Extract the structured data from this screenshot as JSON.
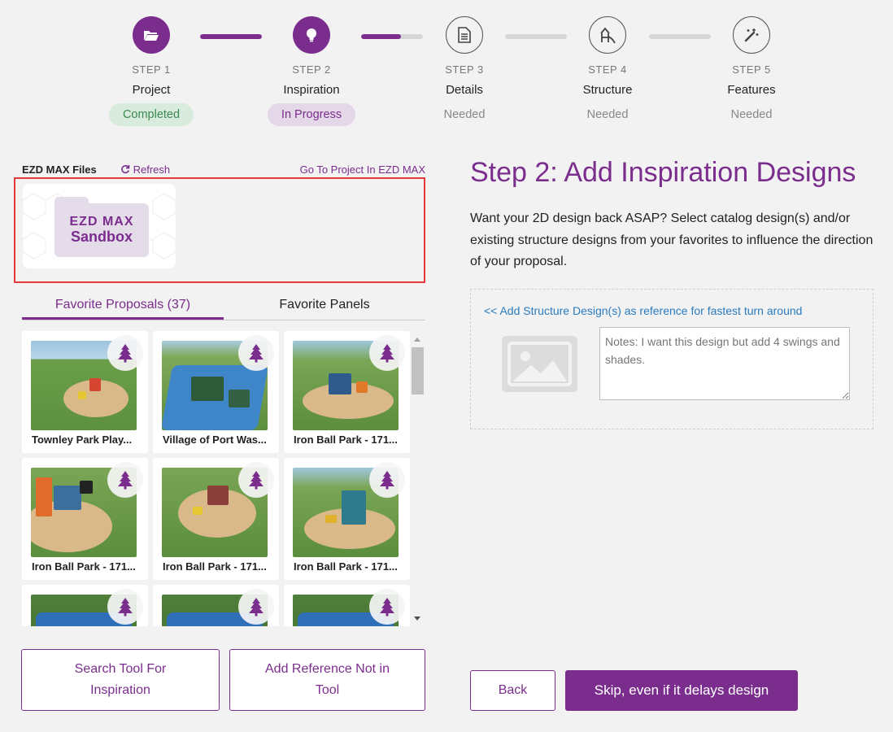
{
  "colors": {
    "accent": "#7b2d8e",
    "completed_bg": "#d9ebdd",
    "completed_text": "#3a8a50",
    "progress_bg": "#e4d7e8",
    "link_blue": "#2a7bbf",
    "highlight_red": "#e33b3b"
  },
  "steps": [
    {
      "number": "STEP 1",
      "name": "Project",
      "status": "Completed",
      "icon": "folder-open-icon"
    },
    {
      "number": "STEP 2",
      "name": "Inspiration",
      "status": "In Progress",
      "icon": "lightbulb-icon"
    },
    {
      "number": "STEP 3",
      "name": "Details",
      "status": "Needed",
      "icon": "document-icon"
    },
    {
      "number": "STEP 4",
      "name": "Structure",
      "status": "Needed",
      "icon": "playground-structure-icon"
    },
    {
      "number": "STEP 5",
      "name": "Features",
      "status": "Needed",
      "icon": "magic-wand-icon"
    }
  ],
  "connector_progress": [
    1.0,
    0.65,
    0.0,
    0.0
  ],
  "files": {
    "title": "EZD MAX Files",
    "refresh_label": "Refresh",
    "goto_label": "Go To Project In EZD MAX",
    "folder_line1": "EZD MAX",
    "folder_line2": "Sandbox"
  },
  "tabs": {
    "active": "Favorite Proposals (37)",
    "other": "Favorite Panels"
  },
  "proposals": [
    {
      "title": "Townley Park Play...",
      "icon": "tree-icon"
    },
    {
      "title": "Village of Port Was...",
      "icon": "tree-icon"
    },
    {
      "title": "Iron Ball Park - 171...",
      "icon": "tree-icon"
    },
    {
      "title": "Iron Ball Park - 171...",
      "icon": "tree-icon"
    },
    {
      "title": "Iron Ball Park - 171...",
      "icon": "tree-icon"
    },
    {
      "title": "Iron Ball Park - 171...",
      "icon": "tree-icon"
    },
    {
      "title": "",
      "icon": "tree-icon"
    },
    {
      "title": "",
      "icon": "tree-icon"
    },
    {
      "title": "",
      "icon": "tree-icon"
    }
  ],
  "left_buttons": {
    "search": "Search Tool For Inspiration",
    "add_ref": "Add Reference Not in Tool"
  },
  "main": {
    "title": "Step 2: Add Inspiration Designs",
    "description": "Want your 2D design back ASAP? Select catalog design(s) and/or existing structure designs from your favorites to influence the direction of your proposal.",
    "add_structure_link": "<< Add Structure Design(s) as reference for fastest turn around",
    "notes_placeholder": "Notes: I want this design but add 4 swings and shades."
  },
  "actions": {
    "back": "Back",
    "skip": "Skip, even if it delays design"
  }
}
